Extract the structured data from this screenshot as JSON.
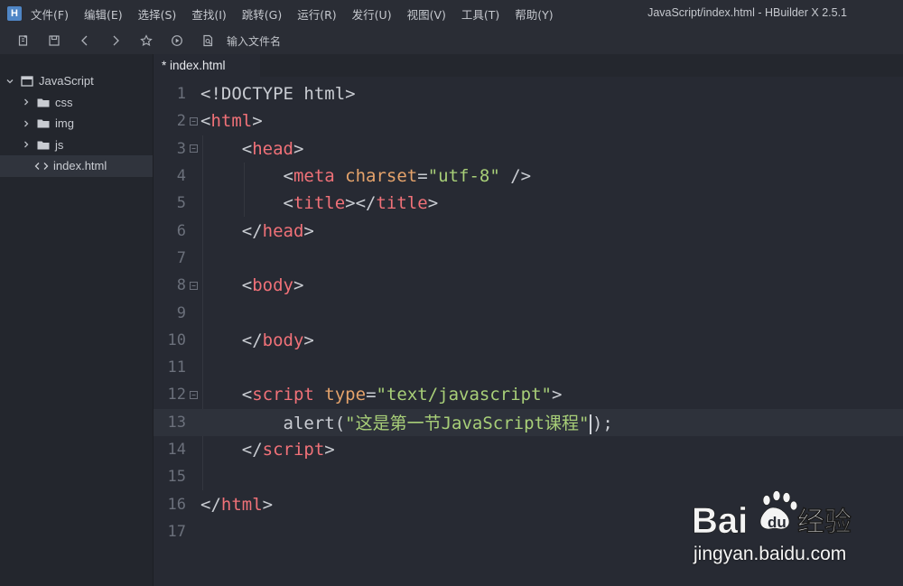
{
  "app": {
    "logo_letter": "H",
    "window_title": "JavaScript/index.html - HBuilder X 2.5.1"
  },
  "menu": [
    "文件(F)",
    "编辑(E)",
    "选择(S)",
    "查找(I)",
    "跳转(G)",
    "运行(R)",
    "发行(U)",
    "视图(V)",
    "工具(T)",
    "帮助(Y)"
  ],
  "toolbar": {
    "buttons": [
      "new-file-icon",
      "save-icon",
      "back-icon",
      "forward-icon",
      "star-icon",
      "run-icon",
      "browser-preview-icon"
    ],
    "search_placeholder": "输入文件名"
  },
  "sidebar": {
    "root": "JavaScript",
    "folders": [
      "css",
      "img",
      "js"
    ],
    "files": [
      "index.html"
    ]
  },
  "tabs": [
    {
      "label": "* index.html",
      "active": true
    }
  ],
  "editor": {
    "current_line": 13,
    "lines": [
      {
        "n": "1",
        "fold": false,
        "tokens": [
          [
            "punc",
            "<!DOCTYPE html>"
          ]
        ]
      },
      {
        "n": "2",
        "fold": true,
        "tokens": [
          [
            "punc",
            "<"
          ],
          [
            "tag",
            "html"
          ],
          [
            "punc",
            ">"
          ]
        ]
      },
      {
        "n": "3",
        "fold": true,
        "tokens": [
          [
            "punc",
            "    <"
          ],
          [
            "tag",
            "head"
          ],
          [
            "punc",
            ">"
          ]
        ]
      },
      {
        "n": "4",
        "fold": false,
        "tokens": [
          [
            "punc",
            "        <"
          ],
          [
            "tag",
            "meta"
          ],
          [
            "punc",
            " "
          ],
          [
            "attr",
            "charset"
          ],
          [
            "punc",
            "="
          ],
          [
            "str",
            "\"utf-8\""
          ],
          [
            "punc",
            " />"
          ]
        ]
      },
      {
        "n": "5",
        "fold": false,
        "tokens": [
          [
            "punc",
            "        <"
          ],
          [
            "tag",
            "title"
          ],
          [
            "punc",
            "></"
          ],
          [
            "tag",
            "title"
          ],
          [
            "punc",
            ">"
          ]
        ]
      },
      {
        "n": "6",
        "fold": false,
        "tokens": [
          [
            "punc",
            "    </"
          ],
          [
            "tag",
            "head"
          ],
          [
            "punc",
            ">"
          ]
        ]
      },
      {
        "n": "7",
        "fold": false,
        "tokens": []
      },
      {
        "n": "8",
        "fold": true,
        "tokens": [
          [
            "punc",
            "    <"
          ],
          [
            "tag",
            "body"
          ],
          [
            "punc",
            ">"
          ]
        ]
      },
      {
        "n": "9",
        "fold": false,
        "tokens": []
      },
      {
        "n": "10",
        "fold": false,
        "tokens": [
          [
            "punc",
            "    </"
          ],
          [
            "tag",
            "body"
          ],
          [
            "punc",
            ">"
          ]
        ]
      },
      {
        "n": "11",
        "fold": false,
        "tokens": []
      },
      {
        "n": "12",
        "fold": true,
        "tokens": [
          [
            "punc",
            "    <"
          ],
          [
            "tag",
            "script"
          ],
          [
            "punc",
            " "
          ],
          [
            "attr",
            "type"
          ],
          [
            "punc",
            "="
          ],
          [
            "str",
            "\"text/javascript\""
          ],
          [
            "punc",
            ">"
          ]
        ]
      },
      {
        "n": "13",
        "fold": false,
        "tokens": [
          [
            "punc",
            "        "
          ],
          [
            "fn",
            "alert"
          ],
          [
            "punc",
            "("
          ],
          [
            "str",
            "\"这是第一节JavaScript课程\""
          ],
          [
            "cursor",
            ""
          ],
          [
            "punc",
            ");"
          ]
        ]
      },
      {
        "n": "14",
        "fold": false,
        "tokens": [
          [
            "punc",
            "    </"
          ],
          [
            "tag",
            "script"
          ],
          [
            "punc",
            ">"
          ]
        ]
      },
      {
        "n": "15",
        "fold": false,
        "tokens": []
      },
      {
        "n": "16",
        "fold": false,
        "tokens": [
          [
            "punc",
            "</"
          ],
          [
            "tag",
            "html"
          ],
          [
            "punc",
            ">"
          ]
        ]
      },
      {
        "n": "17",
        "fold": false,
        "tokens": []
      }
    ]
  },
  "watermark": {
    "brand": "Bai du 经验",
    "url": "jingyan.baidu.com"
  },
  "colors": {
    "tag": "#f07178",
    "attr": "#e5a36b",
    "string": "#a8cf78",
    "text": "#c9ccd2",
    "line_number": "#6b707b",
    "background": "#272a33"
  }
}
